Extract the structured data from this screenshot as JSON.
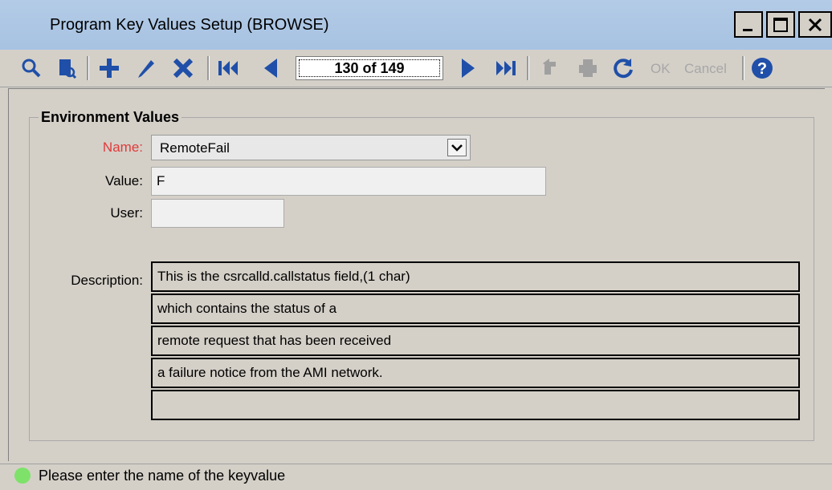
{
  "window": {
    "title": "Program Key Values Setup (BROWSE)"
  },
  "toolbar": {
    "record_position": "130 of 149",
    "ok_label": "OK",
    "cancel_label": "Cancel"
  },
  "form": {
    "group_title": "Environment Values",
    "name_label": "Name:",
    "name_value": "RemoteFail",
    "value_label": "Value:",
    "value_value": "F",
    "user_label": "User:",
    "user_value": "",
    "description_label": "Description:",
    "description_lines": [
      "This is the csrcalld.callstatus field,(1 char)",
      "which contains the status of a",
      "remote request that has been received",
      "a failure notice from the AMI network.",
      ""
    ]
  },
  "status": {
    "message": "Please enter the name of the keyvalue"
  },
  "colors": {
    "title_bar": "#a7c2e2",
    "required_label": "#e03a3a",
    "toolbar_icon": "#1f4fa8",
    "status_ok": "#7ee26a"
  }
}
